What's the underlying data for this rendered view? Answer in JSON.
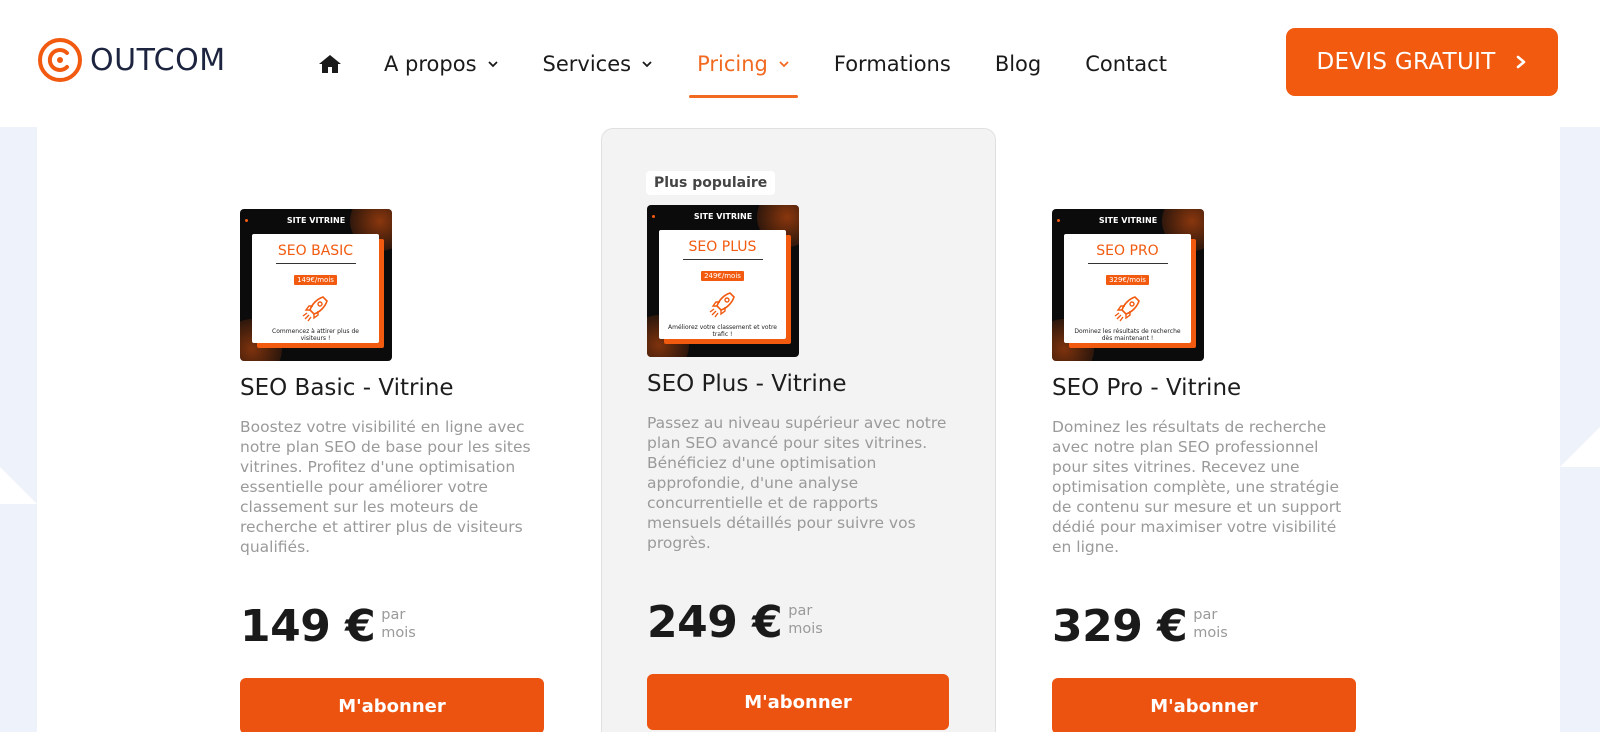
{
  "header": {
    "logo_text": "OUTCOM",
    "nav": [
      {
        "label": "A propos",
        "has_dropdown": true,
        "active": false
      },
      {
        "label": "Services",
        "has_dropdown": true,
        "active": false
      },
      {
        "label": "Pricing",
        "has_dropdown": true,
        "active": true
      },
      {
        "label": "Formations",
        "has_dropdown": false,
        "active": false
      },
      {
        "label": "Blog",
        "has_dropdown": false,
        "active": false
      },
      {
        "label": "Contact",
        "has_dropdown": false,
        "active": false
      }
    ],
    "cta_label": "DEVIS GRATUIT"
  },
  "popular_badge": "Plus populaire",
  "plans": [
    {
      "thumb_header": "SITE VITRINE",
      "thumb_name": "SEO BASIC",
      "thumb_price": "149€/mois",
      "thumb_tagline": "Commencez à attirer plus de visiteurs !",
      "title": "SEO Basic - Vitrine",
      "description": "Boostez votre visibilité en ligne avec notre plan SEO de base pour les sites vitrines. Profitez d'une optimisation essentielle pour améliorer votre classement sur les moteurs de recherche et attirer plus de visiteurs qualifiés.",
      "price": "149 €",
      "period": "par mois",
      "button": "M'abonner"
    },
    {
      "thumb_header": "SITE VITRINE",
      "thumb_name": "SEO PLUS",
      "thumb_price": "249€/mois",
      "thumb_tagline": "Améliorez votre classement et votre trafic !",
      "title": "SEO Plus - Vitrine",
      "description": "Passez au niveau supérieur avec notre plan SEO avancé pour sites vitrines. Bénéficiez d'une optimisation approfondie, d'une analyse concurrentielle et de rapports mensuels détaillés pour suivre vos progrès.",
      "price": "249 €",
      "period": "par mois",
      "button": "M'abonner"
    },
    {
      "thumb_header": "SITE VITRINE",
      "thumb_name": "SEO PRO",
      "thumb_price": "329€/mois",
      "thumb_tagline": "Dominez les résultats de recherche dès maintenant !",
      "title": "SEO Pro - Vitrine",
      "description": "Dominez les résultats de recherche avec notre plan SEO professionnel pour sites vitrines. Recevez une optimisation complète, une stratégie de contenu sur mesure et un support dédié pour maximiser votre visibilité en ligne.",
      "price": "329 €",
      "period": "par mois",
      "button": "M'abonner"
    }
  ],
  "colors": {
    "accent": "#f15a0f",
    "text_dark": "#1d1d1d",
    "text_muted": "#9a9a9a",
    "popular_bg": "#f3f3f3"
  }
}
